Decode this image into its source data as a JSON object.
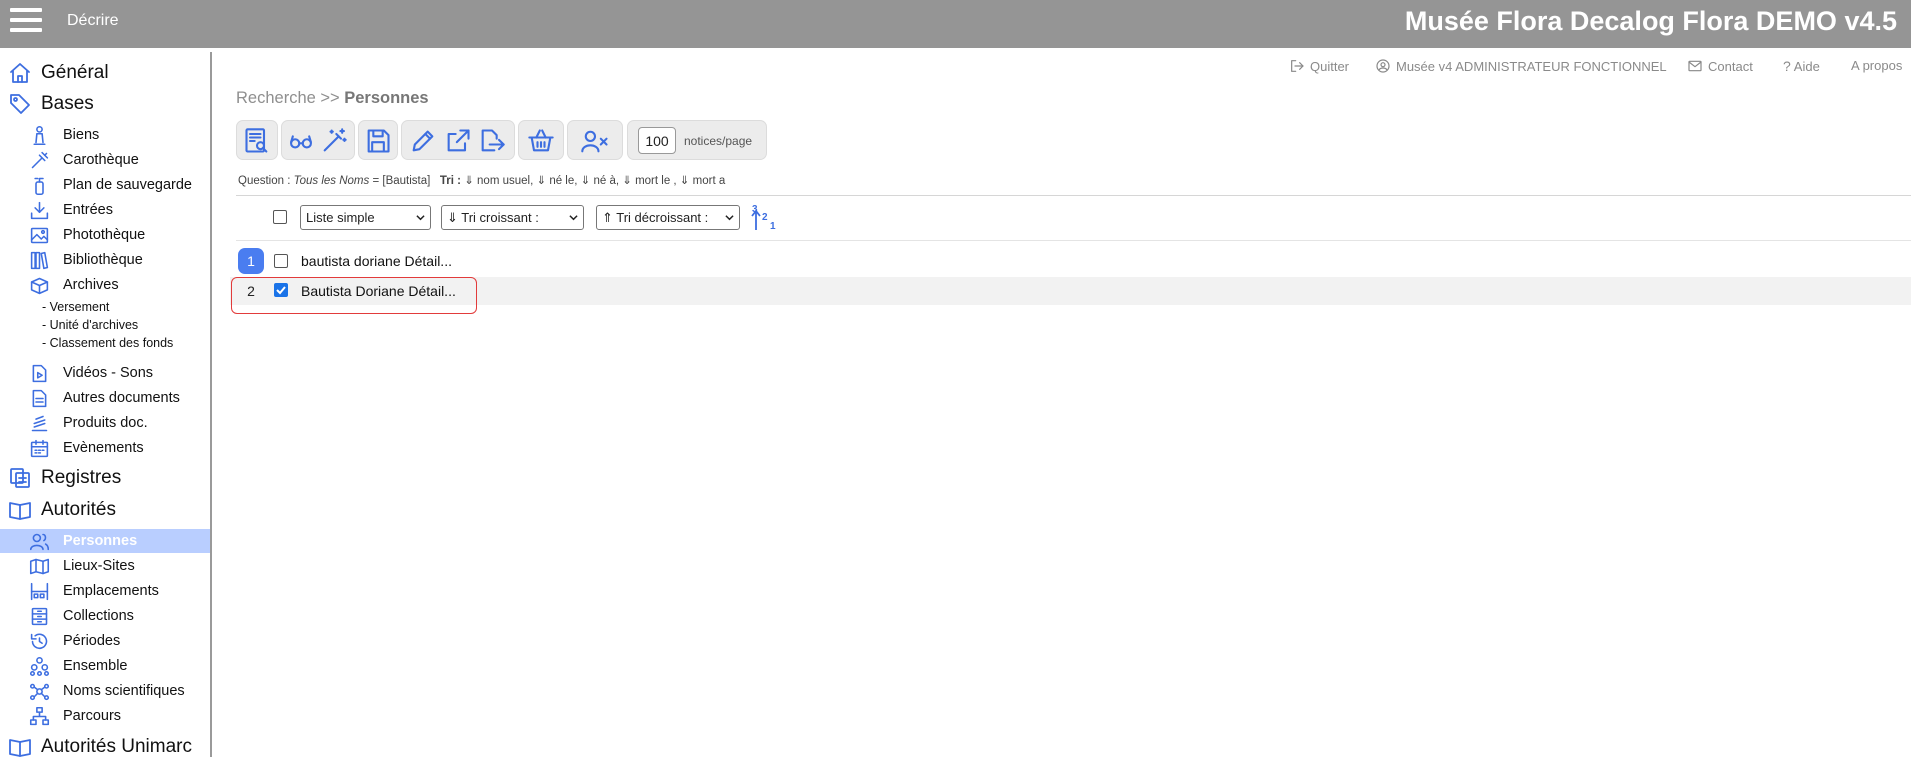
{
  "header": {
    "menu_label": "Décrire",
    "app_title": "Musée Flora Decalog Flora DEMO v4.5"
  },
  "sidebar": {
    "sections": [
      {
        "id": "general",
        "label": "Général"
      },
      {
        "id": "bases",
        "label": "Bases"
      },
      {
        "id": "registres",
        "label": "Registres"
      },
      {
        "id": "autorites",
        "label": "Autorités"
      },
      {
        "id": "autorites_unimarc",
        "label": "Autorités Unimarc"
      }
    ],
    "bases_items": [
      "Biens",
      "Carothèque",
      "Plan de sauvegarde",
      "Entrées",
      "Photothèque",
      "Bibliothèque",
      "Archives",
      "Vidéos - Sons",
      "Autres documents",
      "Produits doc.",
      "Evènements"
    ],
    "archives_children": [
      "- Versement",
      "- Unité d'archives",
      "- Classement des fonds"
    ],
    "autorites_items": [
      "Personnes",
      "Lieux-Sites",
      "Emplacements",
      "Collections",
      "Périodes",
      "Ensemble",
      "Noms scientifiques",
      "Parcours"
    ],
    "active_item": "Personnes"
  },
  "toplinks": {
    "quit": "Quitter",
    "user": "Musée v4 ADMINISTRATEUR FONCTIONNEL",
    "contact": "Contact",
    "help": "Aide",
    "about": "A propos"
  },
  "breadcrumb": {
    "prefix": "Recherche >> ",
    "current": "Personnes"
  },
  "toolbar": {
    "per_page_value": "100",
    "per_page_label": "notices/page"
  },
  "question": {
    "label": "Question : ",
    "field": "Tous les Noms",
    "value": " = [Bautista]",
    "sort_label": "Tri : ",
    "sort_text": "⇓ nom usuel, ⇓ né le, ⇓ né à, ⇓ mort le , ⇓ mort a"
  },
  "controls": {
    "display_mode": "Liste simple",
    "sort_asc": "⇓ Tri croissant :",
    "sort_desc": "⇑ Tri décroissant :",
    "sort_icon_digits": [
      "3",
      "2",
      "1"
    ]
  },
  "results": [
    {
      "number": "1",
      "text": "bautista doriane Détail...",
      "checked": false
    },
    {
      "number": "2",
      "text": "Bautista Doriane Détail...",
      "checked": true
    }
  ],
  "colors": {
    "header_bg": "#959595",
    "accent": "#3d6ee0",
    "active_bg": "#b9ceff",
    "highlight": "#e23b3b"
  }
}
